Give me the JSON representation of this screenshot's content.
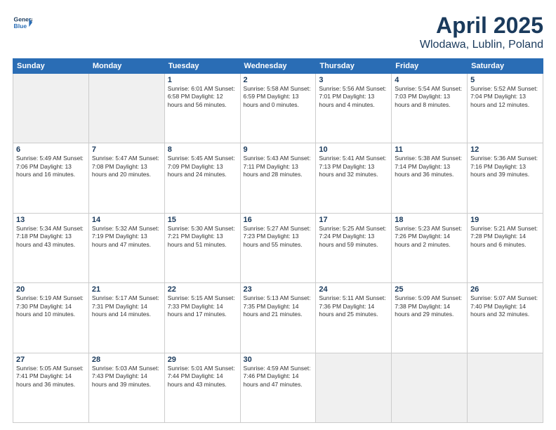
{
  "header": {
    "logo_line1": "General",
    "logo_line2": "Blue",
    "month_title": "April 2025",
    "location": "Wlodawa, Lublin, Poland"
  },
  "weekdays": [
    "Sunday",
    "Monday",
    "Tuesday",
    "Wednesday",
    "Thursday",
    "Friday",
    "Saturday"
  ],
  "weeks": [
    [
      {
        "day": "",
        "info": ""
      },
      {
        "day": "",
        "info": ""
      },
      {
        "day": "1",
        "info": "Sunrise: 6:01 AM\nSunset: 6:58 PM\nDaylight: 12 hours\nand 56 minutes."
      },
      {
        "day": "2",
        "info": "Sunrise: 5:58 AM\nSunset: 6:59 PM\nDaylight: 13 hours\nand 0 minutes."
      },
      {
        "day": "3",
        "info": "Sunrise: 5:56 AM\nSunset: 7:01 PM\nDaylight: 13 hours\nand 4 minutes."
      },
      {
        "day": "4",
        "info": "Sunrise: 5:54 AM\nSunset: 7:03 PM\nDaylight: 13 hours\nand 8 minutes."
      },
      {
        "day": "5",
        "info": "Sunrise: 5:52 AM\nSunset: 7:04 PM\nDaylight: 13 hours\nand 12 minutes."
      }
    ],
    [
      {
        "day": "6",
        "info": "Sunrise: 5:49 AM\nSunset: 7:06 PM\nDaylight: 13 hours\nand 16 minutes."
      },
      {
        "day": "7",
        "info": "Sunrise: 5:47 AM\nSunset: 7:08 PM\nDaylight: 13 hours\nand 20 minutes."
      },
      {
        "day": "8",
        "info": "Sunrise: 5:45 AM\nSunset: 7:09 PM\nDaylight: 13 hours\nand 24 minutes."
      },
      {
        "day": "9",
        "info": "Sunrise: 5:43 AM\nSunset: 7:11 PM\nDaylight: 13 hours\nand 28 minutes."
      },
      {
        "day": "10",
        "info": "Sunrise: 5:41 AM\nSunset: 7:13 PM\nDaylight: 13 hours\nand 32 minutes."
      },
      {
        "day": "11",
        "info": "Sunrise: 5:38 AM\nSunset: 7:14 PM\nDaylight: 13 hours\nand 36 minutes."
      },
      {
        "day": "12",
        "info": "Sunrise: 5:36 AM\nSunset: 7:16 PM\nDaylight: 13 hours\nand 39 minutes."
      }
    ],
    [
      {
        "day": "13",
        "info": "Sunrise: 5:34 AM\nSunset: 7:18 PM\nDaylight: 13 hours\nand 43 minutes."
      },
      {
        "day": "14",
        "info": "Sunrise: 5:32 AM\nSunset: 7:19 PM\nDaylight: 13 hours\nand 47 minutes."
      },
      {
        "day": "15",
        "info": "Sunrise: 5:30 AM\nSunset: 7:21 PM\nDaylight: 13 hours\nand 51 minutes."
      },
      {
        "day": "16",
        "info": "Sunrise: 5:27 AM\nSunset: 7:23 PM\nDaylight: 13 hours\nand 55 minutes."
      },
      {
        "day": "17",
        "info": "Sunrise: 5:25 AM\nSunset: 7:24 PM\nDaylight: 13 hours\nand 59 minutes."
      },
      {
        "day": "18",
        "info": "Sunrise: 5:23 AM\nSunset: 7:26 PM\nDaylight: 14 hours\nand 2 minutes."
      },
      {
        "day": "19",
        "info": "Sunrise: 5:21 AM\nSunset: 7:28 PM\nDaylight: 14 hours\nand 6 minutes."
      }
    ],
    [
      {
        "day": "20",
        "info": "Sunrise: 5:19 AM\nSunset: 7:30 PM\nDaylight: 14 hours\nand 10 minutes."
      },
      {
        "day": "21",
        "info": "Sunrise: 5:17 AM\nSunset: 7:31 PM\nDaylight: 14 hours\nand 14 minutes."
      },
      {
        "day": "22",
        "info": "Sunrise: 5:15 AM\nSunset: 7:33 PM\nDaylight: 14 hours\nand 17 minutes."
      },
      {
        "day": "23",
        "info": "Sunrise: 5:13 AM\nSunset: 7:35 PM\nDaylight: 14 hours\nand 21 minutes."
      },
      {
        "day": "24",
        "info": "Sunrise: 5:11 AM\nSunset: 7:36 PM\nDaylight: 14 hours\nand 25 minutes."
      },
      {
        "day": "25",
        "info": "Sunrise: 5:09 AM\nSunset: 7:38 PM\nDaylight: 14 hours\nand 29 minutes."
      },
      {
        "day": "26",
        "info": "Sunrise: 5:07 AM\nSunset: 7:40 PM\nDaylight: 14 hours\nand 32 minutes."
      }
    ],
    [
      {
        "day": "27",
        "info": "Sunrise: 5:05 AM\nSunset: 7:41 PM\nDaylight: 14 hours\nand 36 minutes."
      },
      {
        "day": "28",
        "info": "Sunrise: 5:03 AM\nSunset: 7:43 PM\nDaylight: 14 hours\nand 39 minutes."
      },
      {
        "day": "29",
        "info": "Sunrise: 5:01 AM\nSunset: 7:44 PM\nDaylight: 14 hours\nand 43 minutes."
      },
      {
        "day": "30",
        "info": "Sunrise: 4:59 AM\nSunset: 7:46 PM\nDaylight: 14 hours\nand 47 minutes."
      },
      {
        "day": "",
        "info": ""
      },
      {
        "day": "",
        "info": ""
      },
      {
        "day": "",
        "info": ""
      }
    ]
  ]
}
